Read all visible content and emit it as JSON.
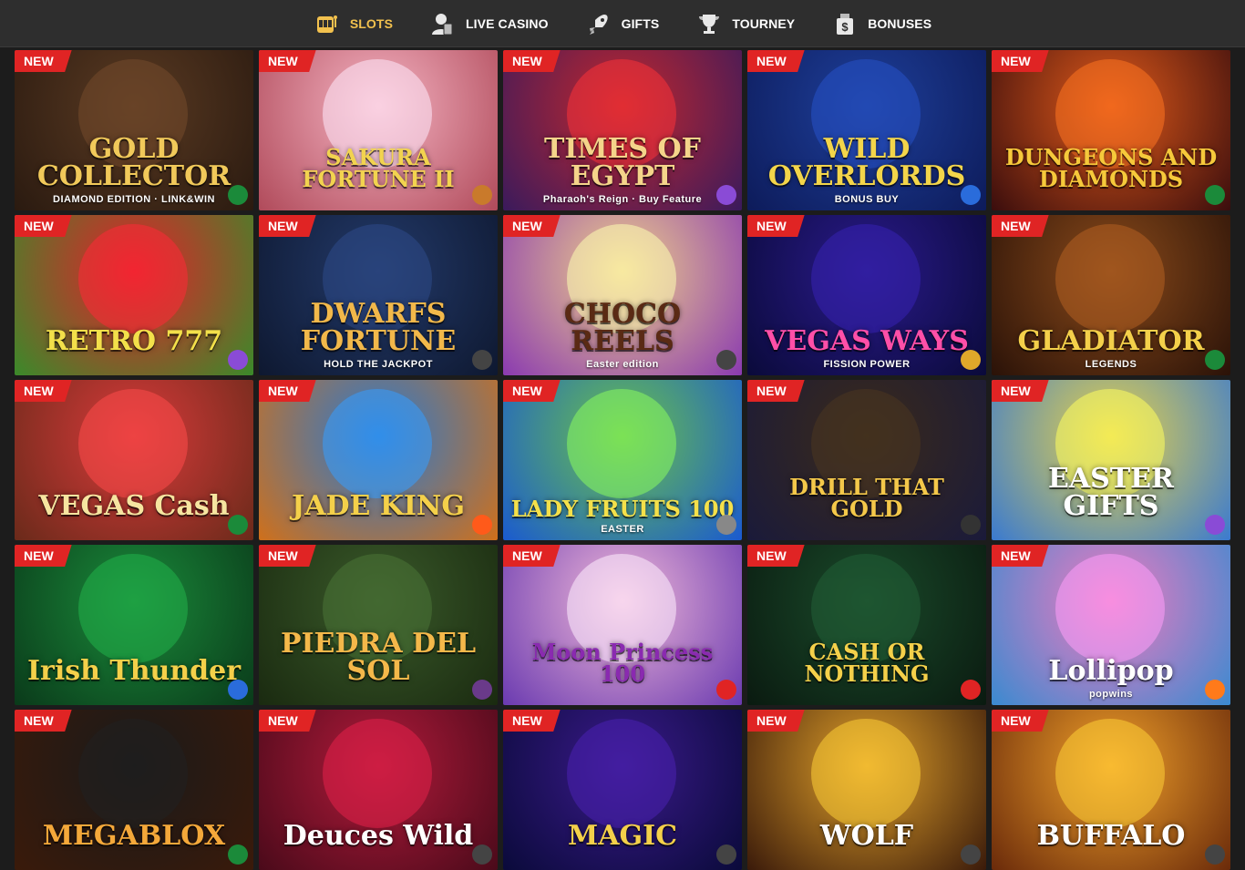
{
  "nav": [
    {
      "label": "SLOTS",
      "icon": "slot-machine-icon",
      "active": true
    },
    {
      "label": "LIVE CASINO",
      "icon": "dealer-icon",
      "active": false
    },
    {
      "label": "GIFTS",
      "icon": "rocket-icon",
      "active": false
    },
    {
      "label": "TOURNEY",
      "icon": "trophy-icon",
      "active": false
    },
    {
      "label": "BONUSES",
      "icon": "dollar-bag-icon",
      "active": false
    }
  ],
  "badge_label": "NEW",
  "games": [
    {
      "title": "GOLD COLLECTOR",
      "sub": "DIAMOND EDITION · LINK&WIN",
      "bg": "#5a3a22",
      "bg2": "#2a1a10",
      "color": "#f1c95a",
      "prov_color": "#1b8a3a"
    },
    {
      "title": "SAKURA FORTUNE II",
      "sub": "",
      "bg": "#f4b3c2",
      "bg2": "#b04a5a",
      "color": "#f2d34f",
      "prov_color": "#c97a2b"
    },
    {
      "title": "TIMES OF EGYPT",
      "sub": "Pharaoh's Reign · Buy Feature",
      "bg": "#c1272d",
      "bg2": "#3a1a5c",
      "color": "#f4d48a",
      "prov_color": "#8a4bd6"
    },
    {
      "title": "WILD OVERLORDS",
      "sub": "BONUS BUY",
      "bg": "#1e3f9a",
      "bg2": "#0d1b5a",
      "color": "#f3d54a",
      "prov_color": "#2a6cdb"
    },
    {
      "title": "DUNGEONS AND DIAMONDS",
      "sub": "",
      "bg": "#e05a1a",
      "bg2": "#3a0d0d",
      "color": "#f6c93b",
      "prov_color": "#1b8a3a"
    },
    {
      "title": "RETRO 777",
      "sub": "",
      "bg": "#e3202a",
      "bg2": "#3a8a2a",
      "color": "#f3e04a",
      "prov_color": "#8a4bd6"
    },
    {
      "title": "DWARFS FORTUNE",
      "sub": "HOLD THE JACKPOT",
      "bg": "#233a6a",
      "bg2": "#0e1830",
      "color": "#f2b84a",
      "prov_color": "#444444"
    },
    {
      "title": "CHOCO REELS",
      "sub": "Easter edition",
      "bg": "#f0d08a",
      "bg2": "#8a3ab0",
      "color": "#5a2a14",
      "prov_color": "#444444"
    },
    {
      "title": "VEGAS WAYS",
      "sub": "FISSION POWER",
      "bg": "#2a1a8a",
      "bg2": "#0a0a3a",
      "color": "#ff4fa8",
      "prov_color": "#e0a82a"
    },
    {
      "title": "GLADIATOR",
      "sub": "LEGENDS",
      "bg": "#8a4a1a",
      "bg2": "#2a1208",
      "color": "#f4d04a",
      "prov_color": "#1b8a3a"
    },
    {
      "title": "VEGAS Cash",
      "sub": "",
      "bg": "#d83a3a",
      "bg2": "#6a2a1a",
      "color": "#f6e5a0",
      "prov_color": "#1b8a3a"
    },
    {
      "title": "JADE KING",
      "sub": "",
      "bg": "#2a7ad0",
      "bg2": "#d0701a",
      "color": "#f4d04a",
      "prov_color": "#ff5a1a"
    },
    {
      "title": "LADY FRUITS 100",
      "sub": "EASTER",
      "bg": "#6ac24a",
      "bg2": "#1a5ad0",
      "color": "#f4e04a",
      "prov_color": "#888888"
    },
    {
      "title": "DRILL THAT GOLD",
      "sub": "",
      "bg": "#3a2a1a",
      "bg2": "#1a1a3a",
      "color": "#f4c84a",
      "prov_color": "#333333"
    },
    {
      "title": "EASTER GIFTS",
      "sub": "",
      "bg": "#e6d24a",
      "bg2": "#3a7ad0",
      "color": "#ffffff",
      "prov_color": "#8a4bd6"
    },
    {
      "title": "Irish Thunder",
      "sub": "",
      "bg": "#1a8a3a",
      "bg2": "#0a3a1a",
      "color": "#f4d04a",
      "prov_color": "#2a6cdb"
    },
    {
      "title": "PIEDRA DEL SOL",
      "sub": "",
      "bg": "#3a5a2a",
      "bg2": "#1a2a10",
      "color": "#f4b84a",
      "prov_color": "#6a3a8a"
    },
    {
      "title": "Moon Princess 100",
      "sub": "",
      "bg": "#f0b8d8",
      "bg2": "#6a3ab0",
      "color": "#8a2ab0",
      "prov_color": "#e02424"
    },
    {
      "title": "CASH OR NOTHING",
      "sub": "",
      "bg": "#1a4a2a",
      "bg2": "#0a1a10",
      "color": "#f4d04a",
      "prov_color": "#e02424"
    },
    {
      "title": "Lollipop",
      "sub": "popwins",
      "bg": "#f07ac0",
      "bg2": "#3a8ad0",
      "color": "#ffffff",
      "prov_color": "#ff7a1a"
    },
    {
      "title": "MEGABLOX",
      "sub": "",
      "bg": "#1a1a1a",
      "bg2": "#3a1a0a",
      "color": "#f4a83a",
      "prov_color": "#1b8a3a"
    },
    {
      "title": "Deuces Wild",
      "sub": "",
      "bg": "#b01a3a",
      "bg2": "#4a0a1a",
      "color": "#ffffff",
      "prov_color": "#444444"
    },
    {
      "title": "MAGIC",
      "sub": "",
      "bg": "#3a1a8a",
      "bg2": "#0a0a3a",
      "color": "#f4d04a",
      "prov_color": "#444444"
    },
    {
      "title": "WOLF",
      "sub": "",
      "bg": "#e0a02a",
      "bg2": "#3a1a0a",
      "color": "#ffffff",
      "prov_color": "#444444"
    },
    {
      "title": "BUFFALO",
      "sub": "",
      "bg": "#f0a02a",
      "bg2": "#6a2a0a",
      "color": "#ffffff",
      "prov_color": "#444444"
    }
  ]
}
